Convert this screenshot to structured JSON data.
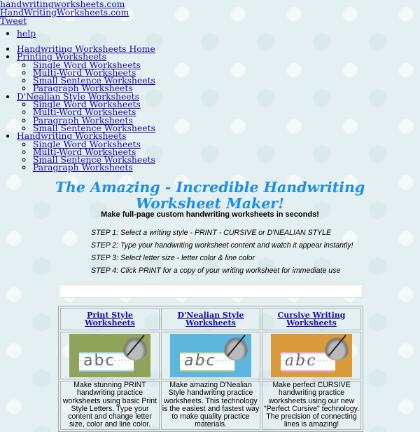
{
  "top_links": [
    "handwritingworksheets.com",
    "HandWritingWorksheets.com",
    "Tweet"
  ],
  "help_link": "help",
  "nav": [
    {
      "label": "Handwriting Worksheets Home",
      "children": []
    },
    {
      "label": "Printing Worksheets",
      "children": [
        "Single Word Worksheets",
        "Multi-Word Worksheets",
        "Small Sentence Worksheets",
        "Paragraph Worksheets"
      ]
    },
    {
      "label": "D'Nealian Style Worksheets",
      "children": [
        "Single Word Worksheets",
        "Multi-Word Worksheets",
        "Paragraph Worksheets",
        "Small Sentence Worksheets"
      ]
    },
    {
      "label": "Handwriting Worksheets",
      "children": [
        "Single Word Worksheets",
        "Multi-Word Worksheets",
        "Small Sentence Worksheets",
        "Paragraph Worksheets"
      ]
    }
  ],
  "title": "The Amazing - Incredible Handwriting Worksheet Maker!",
  "subtitle": "Make full-page custom handwriting worksheets in seconds!",
  "steps": [
    "STEP 1: Select a writing style - PRINT - CURSIVE or D'NEALIAN STYLE",
    "STEP 2: Type your handwriting worksheet content and watch it appear instantly!",
    "STEP 3: Select letter size - letter color & line color",
    "STEP 4: Click PRINT for a copy of your writing worksheet for immediate use"
  ],
  "styles": [
    {
      "heading": "Print Style Worksheets",
      "sample": "abc",
      "bg": "#8fa35a",
      "line": "#8ecde6",
      "description": "Make stunning PRINT handwriting practice worksheets using basic Print Style Letters. Type your content and change letter size, color and line color."
    },
    {
      "heading": "D'Nealian Style Worksheets",
      "sample": "abc",
      "bg": "#5fb6dc",
      "line": "#9ccf8f",
      "description": "Make amazing D'Nealian Style handwriting practice worksheets. This technology is the easiest and fastest way to make quality practice materials."
    },
    {
      "heading": "Cursive Writing Worksheets",
      "sample": "abc",
      "bg": "#d99a3a",
      "line": "#ef9fc8",
      "description": "Make perfect CURSIVE handwriting practice worksheets using our new \"Perfect Cursive\" technology. The precision of connecting lines is amazing!"
    }
  ]
}
